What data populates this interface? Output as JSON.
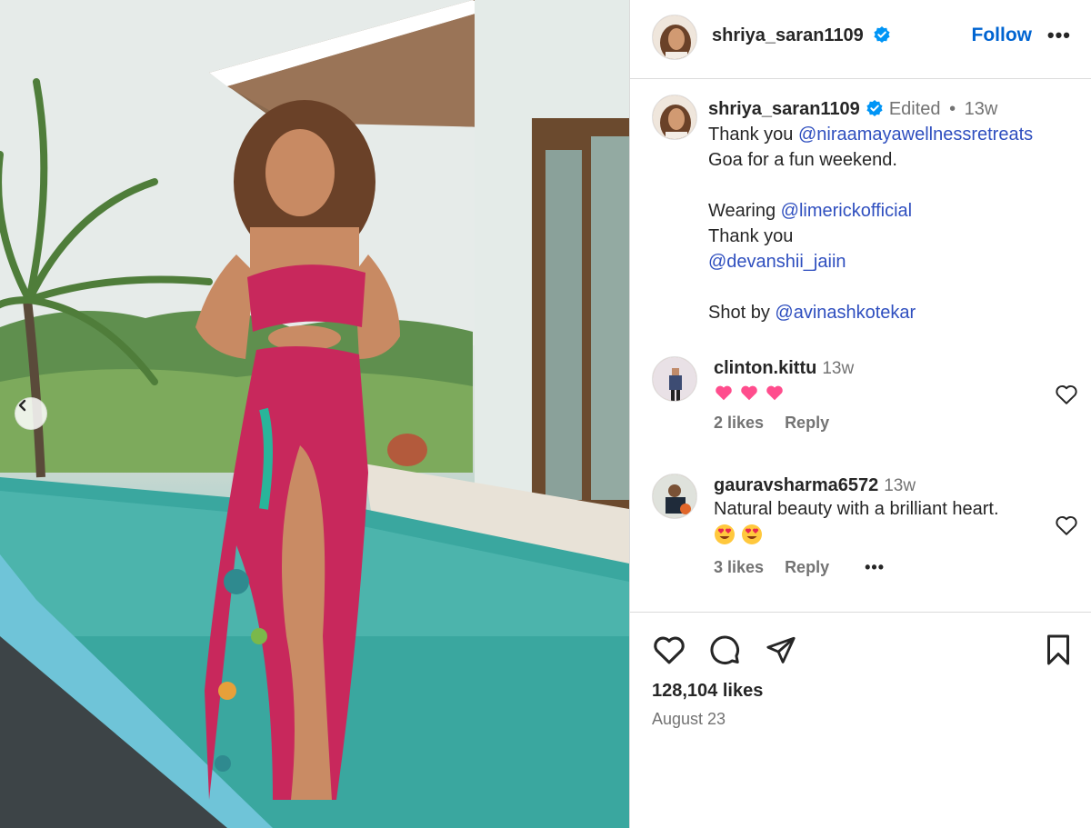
{
  "post": {
    "username": "shriya_saran1109",
    "follow_label": "Follow",
    "more_label": "•••"
  },
  "caption": {
    "username": "shriya_saran1109",
    "edited_label": "Edited",
    "separator": "•",
    "time": "13w",
    "line1_prefix": "Thank you ",
    "mention1": "@niraamayawellnessretreats",
    "line2": "Goa for a fun weekend.",
    "line3_prefix": "Wearing ",
    "mention2": "@limerickofficial",
    "line4": "Thank you",
    "mention3": "@devanshii_jaiin",
    "line5_prefix": "Shot by ",
    "mention4": "@avinashkotekar"
  },
  "comments": [
    {
      "username": "clinton.kittu",
      "time": "13w",
      "emojis": [
        "pink-heart",
        "pink-heart",
        "pink-heart"
      ],
      "likes": "2 likes",
      "reply": "Reply"
    },
    {
      "username": "gauravsharma6572",
      "time": "13w",
      "text": "Natural beauty with a brilliant heart.",
      "emojis": [
        "heart-eyes",
        "heart-eyes"
      ],
      "likes": "3 likes",
      "reply": "Reply",
      "more": "•••"
    }
  ],
  "footer": {
    "likes": "128,104 likes",
    "date": "August 23"
  },
  "icons": {
    "like": "heart-outline-icon",
    "comment": "comment-bubble-icon",
    "share": "paper-plane-icon",
    "save": "bookmark-icon",
    "verified": "verified-badge-icon",
    "carousel_prev": "chevron-left-icon"
  },
  "colors": {
    "link": "#2f4fbf",
    "follow": "#0064d1",
    "verified": "#0095f6",
    "muted": "#737373",
    "divider": "#dbdbdb",
    "dress": "#c8285c"
  }
}
